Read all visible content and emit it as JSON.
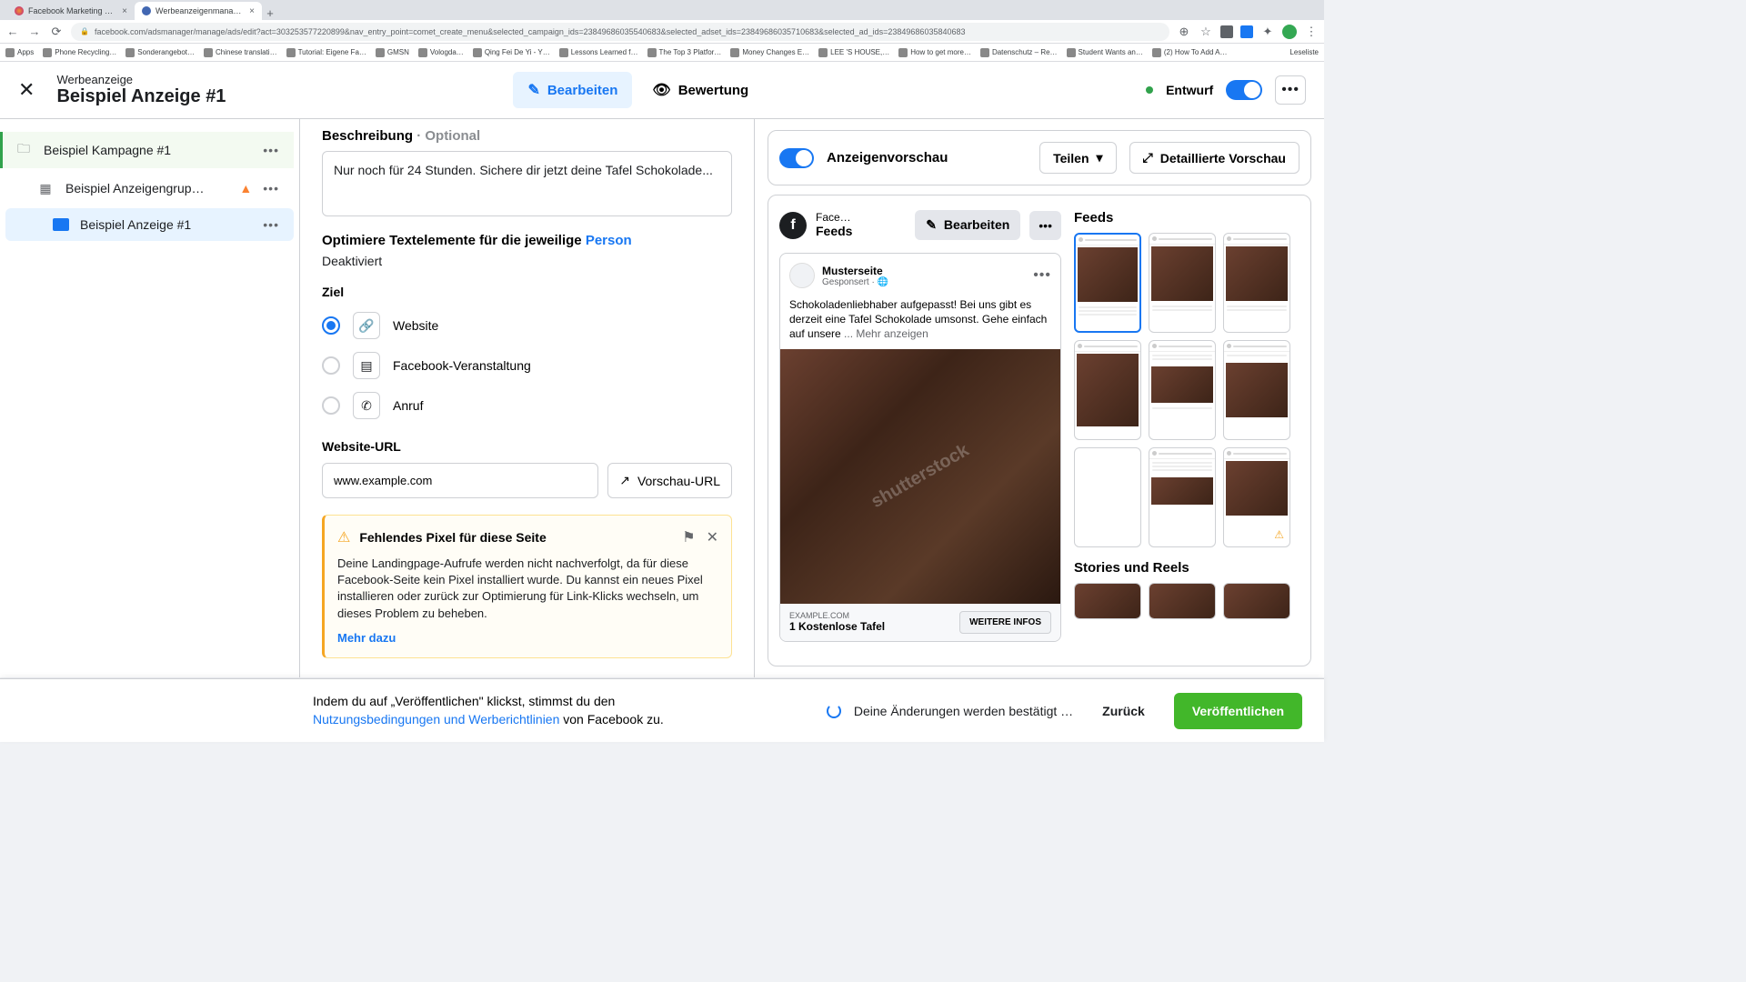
{
  "browser": {
    "tabs": [
      {
        "title": "Facebook Marketing & Werbe…"
      },
      {
        "title": "Werbeanzeigenmanager - We…"
      }
    ],
    "url": "facebook.com/adsmanager/manage/ads/edit?act=303253577220899&nav_entry_point=comet_create_menu&selected_campaign_ids=23849686035540683&selected_adset_ids=23849686035710683&selected_ad_ids=23849686035840683",
    "bookmarks": [
      "Apps",
      "Phone Recycling…",
      "Sonderangebot…",
      "Chinese translati…",
      "Tutorial: Eigene Fa…",
      "GMSN",
      "Vologda…",
      "Qing Fei De Yi - Y…",
      "Lessons Learned f…",
      "The Top 3 Platfor…",
      "Money Changes E…",
      "LEE 'S HOUSE,…",
      "How to get more…",
      "Datenschutz – Re…",
      "Student Wants an…",
      "(2) How To Add A…",
      "Leseliste"
    ]
  },
  "header": {
    "subtitle": "Werbeanzeige",
    "title": "Beispiel Anzeige #1",
    "tab_edit": "Bearbeiten",
    "tab_review": "Bewertung",
    "draft": "Entwurf"
  },
  "sidebar": {
    "campaign": "Beispiel Kampagne #1",
    "adset": "Beispiel Anzeigengrup…",
    "ad": "Beispiel Anzeige #1"
  },
  "form": {
    "desc_label": "Beschreibung",
    "optional": " · Optional",
    "desc_value": "Nur noch für 24 Stunden. Sichere dir jetzt deine Tafel Schokolade...",
    "optimize_prefix": "Optimiere Textelemente für die jeweilige ",
    "optimize_person": "Person",
    "deactivated": "Deaktiviert",
    "ziel": "Ziel",
    "ziel_website": "Website",
    "ziel_event": "Facebook-Veranstaltung",
    "ziel_call": "Anruf",
    "url_label": "Website-URL",
    "url_value": "www.example.com",
    "preview_url": "Vorschau-URL",
    "warn_title": "Fehlendes Pixel für diese Seite",
    "warn_body": "Deine Landingpage-Aufrufe werden nicht nachverfolgt, da für diese Facebook-Seite kein Pixel installiert wurde. Du kannst ein neues Pixel installieren oder zurück zur Optimierung für Link-Klicks wechseln, um dieses Problem zu beheben.",
    "warn_link": "Mehr dazu"
  },
  "preview": {
    "title": "Anzeigenvorschau",
    "share": "Teilen",
    "detail": "Detaillierte Vorschau",
    "placement_platform": "Face…",
    "placement_name": "Feeds",
    "edit": "Bearbeiten",
    "ad_page": "Musterseite",
    "ad_sponsored": "Gesponsert · ",
    "ad_text": "Schokoladenliebhaber aufgepasst! Bei uns gibt es derzeit eine Tafel Schokolade umsonst. Gehe einfach auf unsere ",
    "ad_more": "... Mehr anzeigen",
    "ad_domain": "EXAMPLE.COM",
    "ad_headline": "1 Kostenlose Tafel",
    "cta": "WEITERE INFOS",
    "feeds_title": "Feeds",
    "stories_title": "Stories und Reels"
  },
  "footer": {
    "text_prefix": "Indem du auf „Veröffentlichen\" klickst, stimmst du den ",
    "terms": "Nutzungsbedingungen und Werberichtlinien",
    "text_suffix": " von Facebook zu.",
    "confirm": "Deine Änderungen werden bestätigt …",
    "back": "Zurück",
    "publish": "Veröffentlichen"
  }
}
